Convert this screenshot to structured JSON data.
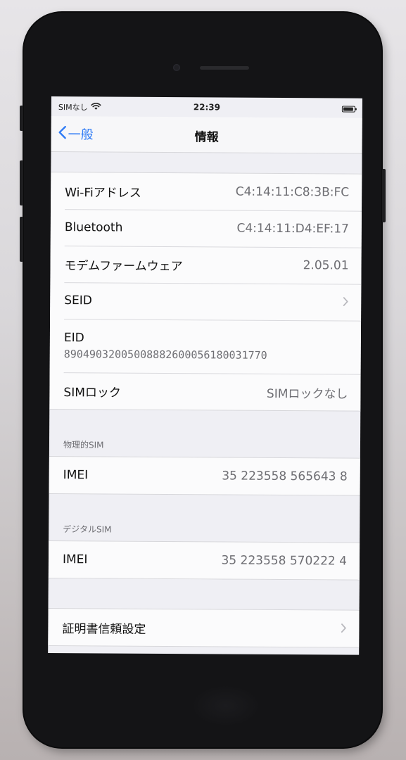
{
  "status": {
    "carrier": "SIMなし",
    "time": "22:39",
    "battery_level": 0.9
  },
  "nav": {
    "back_label": "一般",
    "title": "情報"
  },
  "network_rows": [
    {
      "label": "Wi-Fiアドレス",
      "value": "C4:14:11:C8:3B:FC"
    },
    {
      "label": "Bluetooth",
      "value": "C4:14:11:D4:EF:17"
    },
    {
      "label": "モデムファームウェア",
      "value": "2.05.01"
    },
    {
      "label": "SEID",
      "value": ""
    },
    {
      "label": "EID",
      "value": "89049032005008882600056180031770"
    },
    {
      "label": "SIMロック",
      "value": "SIMロックなし"
    }
  ],
  "physical_sim": {
    "header": "物理的SIM",
    "imei_label": "IMEI",
    "imei_value": "35 223558 565643 8"
  },
  "digital_sim": {
    "header": "デジタルSIM",
    "imei_label": "IMEI",
    "imei_value": "35 223558 570222 4"
  },
  "certificate": {
    "label": "証明書信頼設定"
  },
  "icons": {
    "wifi": "wifi-icon",
    "battery": "battery-icon",
    "back": "chevron-left-icon",
    "disclosure": "chevron-right-icon"
  },
  "colors": {
    "accent": "#2f7bf5",
    "secondary_text": "#6e6e73",
    "background": "#efeff4"
  }
}
